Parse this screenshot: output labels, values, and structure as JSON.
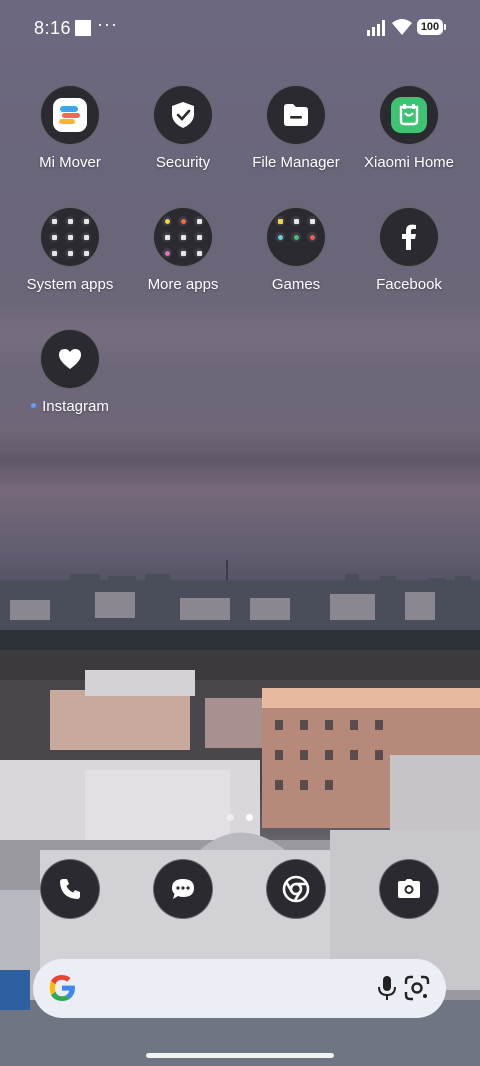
{
  "status_bar": {
    "time": "8:16",
    "more": "···",
    "battery": "100"
  },
  "apps": [
    {
      "id": "mi-mover",
      "label": "Mi Mover"
    },
    {
      "id": "security",
      "label": "Security"
    },
    {
      "id": "file-manager",
      "label": "File Manager"
    },
    {
      "id": "xiaomi-home",
      "label": "Xiaomi Home"
    },
    {
      "id": "system-apps",
      "label": "System apps"
    },
    {
      "id": "more-apps",
      "label": "More apps"
    },
    {
      "id": "games",
      "label": "Games"
    },
    {
      "id": "facebook",
      "label": "Facebook"
    },
    {
      "id": "instagram",
      "label": "Instagram",
      "new_install_dot": true
    }
  ],
  "pager": {
    "pages": 2,
    "active": 2
  },
  "dock": [
    {
      "id": "phone",
      "icon": "phone-icon"
    },
    {
      "id": "messages",
      "icon": "message-icon"
    },
    {
      "id": "chrome",
      "icon": "chrome-icon"
    },
    {
      "id": "camera",
      "icon": "camera-icon"
    }
  ],
  "search_bar": {
    "logo": "google-g-icon",
    "voice": "microphone-icon",
    "lens": "google-lens-icon"
  },
  "colors": {
    "icon_bg": "#2b2a30",
    "mi_mover_bg": "#ffffff",
    "xiaomi_home_bg": "#3ec274",
    "search_bg": "#eceef6"
  }
}
